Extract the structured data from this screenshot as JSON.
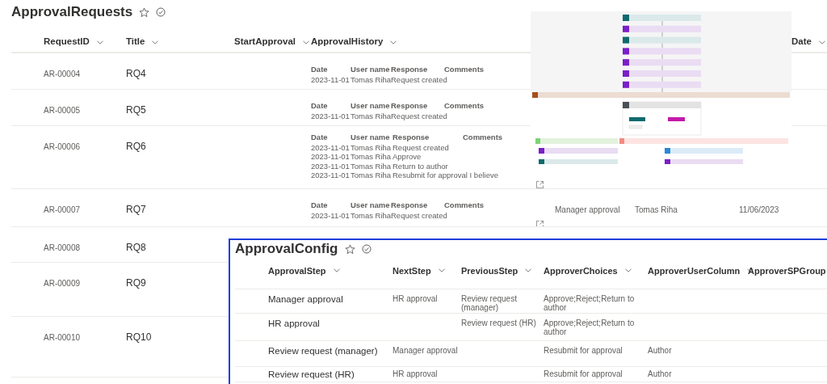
{
  "requests_list": {
    "title": "ApprovalRequests",
    "columns": [
      "RequestID",
      "Title",
      "StartApproval",
      "ApprovalHistory",
      "",
      "",
      "",
      "Date"
    ],
    "rows": [
      {
        "request_id": "AR-00004",
        "title": "RQ4",
        "history": {
          "columns": [
            "Date",
            "User name",
            "Response",
            "Comments"
          ],
          "entries": [
            [
              "2023-11-01",
              "Tomas Riha",
              "Request created"
            ]
          ]
        }
      },
      {
        "request_id": "AR-00005",
        "title": "RQ5",
        "history": {
          "columns": [
            "Date",
            "User name",
            "Response",
            "Comments"
          ],
          "entries": [
            [
              "2023-11-01",
              "Tomas Riha",
              "Request created"
            ]
          ]
        }
      },
      {
        "request_id": "AR-00006",
        "title": "RQ6",
        "history": {
          "columns": [
            "Date",
            "User name",
            "Response",
            "Comments"
          ],
          "entries": [
            [
              "2023-11-01",
              "Tomas Riha",
              "Request created"
            ],
            [
              "2023-11-01",
              "Tomas Riha",
              "Approve"
            ],
            [
              "2023-11-01",
              "Tomas Riha",
              "Return to author"
            ],
            [
              "2023-11-01",
              "Tomas Riha",
              "Resubmit for approval I believe"
            ]
          ]
        },
        "open_link": true
      },
      {
        "request_id": "AR-00007",
        "title": "RQ7",
        "history": {
          "columns": [
            "Date",
            "User name",
            "Response",
            "Comments"
          ],
          "entries": [
            [
              "2023-11-01",
              "Tomas Riha",
              "Request created"
            ]
          ]
        },
        "step": "Manager approval",
        "user": "Tomas Riha",
        "date": "11/06/2023",
        "open_link": true
      },
      {
        "request_id": "AR-00008",
        "title": "RQ8"
      },
      {
        "request_id": "AR-00009",
        "title": "RQ9"
      },
      {
        "request_id": "AR-00010",
        "title": "RQ10"
      }
    ]
  },
  "config_list": {
    "title": "ApprovalConfig",
    "columns": [
      "ApprovalStep",
      "NextStep",
      "PreviousStep",
      "ApproverChoices",
      "ApproverUserColumn",
      "ApproverSPGroup"
    ],
    "rows": [
      {
        "step": "Manager approval",
        "next": "HR approval",
        "previous": "Review request (manager)",
        "choices": "Approve;Reject;Return to author"
      },
      {
        "step": "HR approval",
        "previous": "Review request (HR)",
        "choices": "Approve;Reject;Return to author"
      },
      {
        "step": "Review request (manager)",
        "next": "Manager approval",
        "choices": "Resubmit for approval",
        "user_column": "Author"
      },
      {
        "step": "Review request (HR)",
        "next": "HR approval",
        "choices": "Resubmit for approval",
        "user_column": "Author"
      }
    ]
  }
}
